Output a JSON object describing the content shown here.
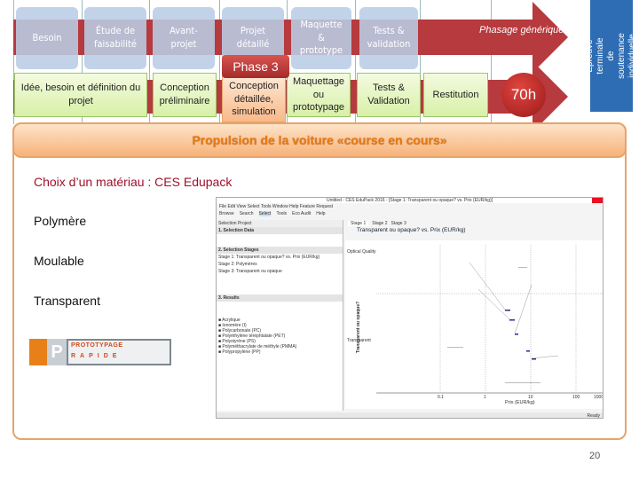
{
  "generic_phases": [
    "Besoin",
    "Étude de faisabilité",
    "Avant-projet",
    "Projet détaillé",
    "Maquette & prototype",
    "Tests & validation"
  ],
  "generic_label": "Phasage générique",
  "phase_tag": "Phase 3",
  "project_phases": [
    "Idée, besoin et définition du projet",
    "Conception préliminaire",
    "Conception détaillée, simulation",
    "Maquettage ou prototypage",
    "Tests & Validation",
    "Restitution"
  ],
  "duration": "70h",
  "final_exam": "Épreuve terminale de soutenance individuelle",
  "banner_title": "Propulsion de la voiture «course en cours»",
  "subtitle": "Choix d’un matériau : CES Edupack",
  "criteria": [
    "Polymère",
    "Moulable",
    "Transparent"
  ],
  "logo_text": "PROTOTYPAGE RAPIDE",
  "page_number": "20",
  "app": {
    "window_title": "Untitled - CES EduPack 2016 - [Stage 1: Transparent ou opaque? vs. Prix (EUR/kg)]",
    "menu": [
      "File",
      "Edit",
      "View",
      "Select",
      "Tools",
      "Window",
      "Help",
      "Feature Request"
    ],
    "toolbar": [
      "Browse",
      "Search",
      "Select",
      "Tools",
      "Eco Audit",
      "Help"
    ],
    "left": {
      "selection_project": "Selection Project",
      "step1": "1. Selection Data",
      "step2": "2. Selection Stages",
      "step3": "3. Results",
      "stages": [
        "Stage 1: Transparent ou opaque? vs. Prix (EUR/kg)",
        "Stage 2: Polymères",
        "Stage 3: Transparent ou opaque"
      ],
      "results": [
        "Acrylique",
        "Ionomère (I)",
        "Polycarbonate (PC)",
        "Polyéthylène téréphtalate (PET)",
        "Polystyrène (PS)",
        "Polyméthacrylate de méthyle (PMMA)",
        "Polypropylène (PP)"
      ]
    },
    "tabs": [
      "Stage 1",
      "Stage 2",
      "Stage 3"
    ],
    "chart_title": "Transparent ou opaque? vs. Prix (EUR/kg)",
    "x_label": "Prix (EUR/kg)",
    "y_label": "Transparent ou opaque?",
    "y_categories": [
      "Optical Quality",
      "Transparent"
    ],
    "x_ticks": [
      "0.1",
      "1",
      "10",
      "100",
      "1000"
    ],
    "status": "Ready"
  },
  "colors": {
    "arrow": "#b63a3e",
    "banner_text": "#e57a10",
    "subtitle": "#a0102a",
    "exam_box": "#2e6db4"
  }
}
